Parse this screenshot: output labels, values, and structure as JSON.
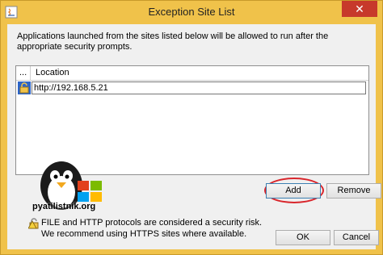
{
  "window": {
    "title": "Exception Site List",
    "close_label": "✕"
  },
  "description": "Applications launched from the sites listed below will be allowed to run after the appropriate security prompts.",
  "list": {
    "columns": [
      "...",
      "Location"
    ],
    "rows": [
      {
        "location": "http://192.168.5.21"
      }
    ]
  },
  "watermark": {
    "text": "pyatilistnik.org"
  },
  "buttons": {
    "add": "Add",
    "remove": "Remove",
    "ok": "OK",
    "cancel": "Cancel"
  },
  "warning": {
    "line1": "FILE and HTTP protocols are considered a security risk.",
    "line2": "We recommend using HTTPS sites where available."
  },
  "colors": {
    "titlebar": "#f0c24a",
    "close": "#c7392b",
    "highlight": "#d9262c"
  }
}
